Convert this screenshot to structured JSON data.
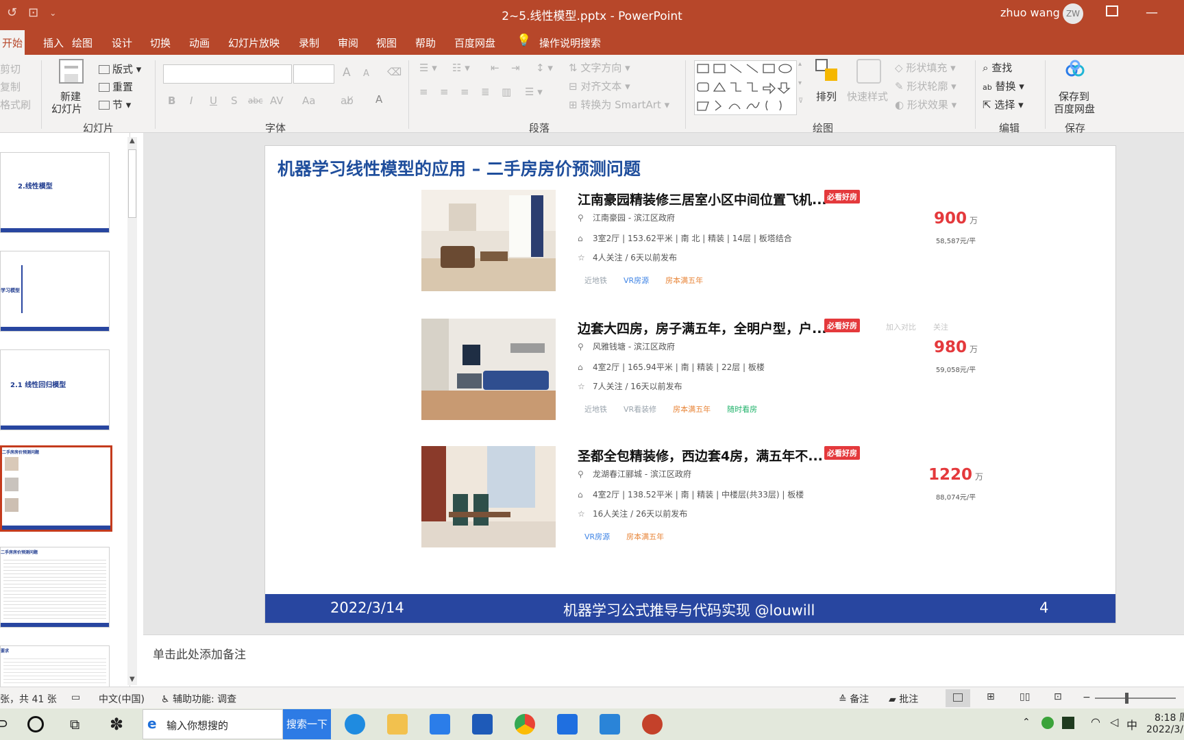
{
  "window": {
    "title": "2~5.线性模型.pptx  -  PowerPoint",
    "user_name": "zhuo wang",
    "user_initials": "ZW"
  },
  "tabs": [
    "开始",
    "插入",
    "绘图",
    "设计",
    "切换",
    "动画",
    "幻灯片放映",
    "录制",
    "审阅",
    "视图",
    "帮助",
    "百度网盘",
    "操作说明搜索"
  ],
  "ribbon": {
    "clipboard": {
      "cut": "剪切",
      "copy": "复制",
      "format_painter": "格式刷"
    },
    "slides": {
      "new_slide": "新建",
      "new_slide2": "幻灯片",
      "layout": "版式",
      "reset": "重置",
      "section": "节",
      "label": "幻灯片"
    },
    "font": {
      "label": "字体",
      "grow": "A",
      "shrink": "A",
      "bold": "B",
      "italic": "I",
      "underline": "U",
      "shadow": "S",
      "strike": "abc",
      "spacing": "AV",
      "case": "Aa",
      "color": "A"
    },
    "paragraph": {
      "label": "段落",
      "text_direction": "文字方向",
      "align_text": "对齐文本",
      "smartart": "转换为 SmartArt"
    },
    "drawing": {
      "label": "绘图",
      "arrange": "排列",
      "quick_styles": "快速样式",
      "shape_fill": "形状填充",
      "shape_outline": "形状轮廓",
      "shape_effects": "形状效果"
    },
    "editing": {
      "label": "编辑",
      "find": "查找",
      "replace": "替换",
      "select": "选择"
    },
    "save": {
      "label": "保存",
      "save_to": "保存到",
      "baidu": "百度网盘"
    }
  },
  "thumbnails": [
    {
      "title": "2.线性模型"
    },
    {
      "title": "学习模型"
    },
    {
      "title": "2.1 线性回归模型"
    },
    {
      "title": "二手房房价预测问题"
    },
    {
      "title": "二手房房价预测问题"
    },
    {
      "title": "要求"
    }
  ],
  "slide": {
    "title": "机器学习线性模型的应用 – 二手房房价预测问题",
    "listings": [
      {
        "title": "江南豪园精装修三居室小区中间位置飞机...",
        "badge": "必看好房",
        "location": "江南豪园 - 滨江区政府",
        "details": "3室2厅 | 153.62平米 | 南 北 | 精装 | 14层 | 板塔结合",
        "follow": "4人关注 / 6天以前发布",
        "tags": [
          "近地铁",
          "VR房源",
          "房本满五年"
        ],
        "price": "900",
        "price_unit": "万",
        "unit_price": "58,587元/平"
      },
      {
        "title": "边套大四房，房子满五年，全明户型，户...",
        "badge": "必看好房",
        "location": "风雅钱塘 - 滨江区政府",
        "details": "4室2厅 | 165.94平米 | 南 | 精装 | 22层 | 板楼",
        "follow": "7人关注 / 16天以前发布",
        "tags": [
          "近地铁",
          "VR看装修",
          "房本满五年",
          "随时看房"
        ],
        "price": "980",
        "price_unit": "万",
        "unit_price": "59,058元/平",
        "compare": "加入对比",
        "watch": "关注"
      },
      {
        "title": "圣都全包精装修，西边套4房，满五年不...",
        "badge": "必看好房",
        "location": "龙湖春江郦城 - 滨江区政府",
        "details": "4室2厅 | 138.52平米 | 南 | 精装 | 中楼层(共33层) | 板楼",
        "follow": "16人关注 / 26天以前发布",
        "tags": [
          "VR房源",
          "房本满五年"
        ],
        "price": "1220",
        "price_unit": "万",
        "unit_price": "88,074元/平"
      }
    ],
    "footer": {
      "date": "2022/3/14",
      "center": "机器学习公式推导与代码实现 @louwill",
      "page": "4"
    }
  },
  "notes_placeholder": "单击此处添加备注",
  "status": {
    "slide_count": "张，共 41 张",
    "language": "中文(中国)",
    "accessibility": "辅助功能: 调查",
    "notes": "备注",
    "comments": "批注"
  },
  "taskbar": {
    "search_placeholder": "输入你想搜的",
    "search_button": "搜索一下",
    "ime": "中",
    "time": "8:18 周",
    "date": "2022/3/"
  },
  "colors": {
    "accent": "#b7472a",
    "slide_blue": "#2846a0",
    "price_red": "#e4393c"
  }
}
